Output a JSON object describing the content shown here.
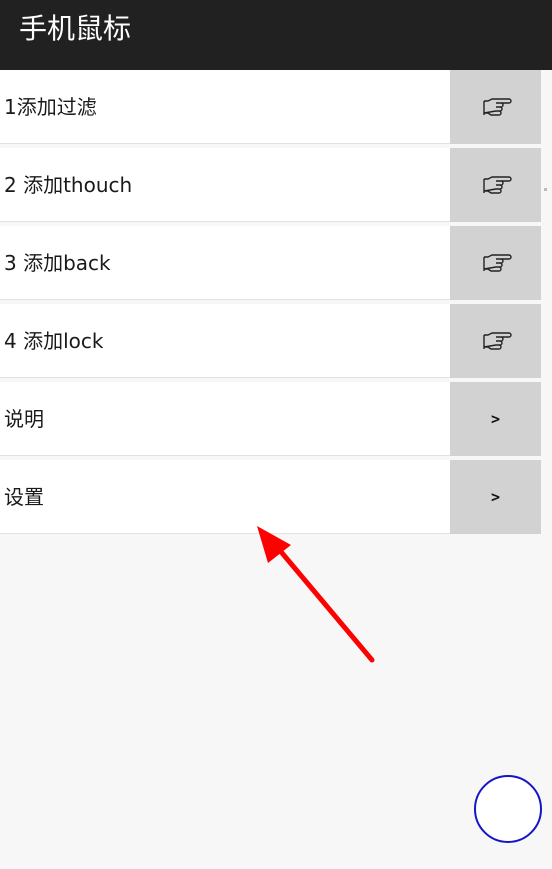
{
  "app_bar": {
    "title": "手机鼠标"
  },
  "menu": {
    "items": [
      {
        "label": "1添加过滤",
        "action_icon": "pointing-hand-icon"
      },
      {
        "label": "2 添加thouch",
        "action_icon": "pointing-hand-icon"
      },
      {
        "label": "3 添加back",
        "action_icon": "pointing-hand-icon"
      },
      {
        "label": "4 添加lock",
        "action_icon": "pointing-hand-icon"
      },
      {
        "label": "说明",
        "action_icon": "chevron-right-icon",
        "action_text": ">"
      },
      {
        "label": "设置",
        "action_icon": "chevron-right-icon",
        "action_text": ">"
      }
    ]
  },
  "annotation": {
    "arrow_color": "#ff0000"
  },
  "floating_button": {
    "icon": "circle-icon",
    "border_color": "#1515c8"
  },
  "colors": {
    "app_bar": "#212121",
    "action_bg": "#d2d2d2",
    "background": "#f7f7f7"
  }
}
